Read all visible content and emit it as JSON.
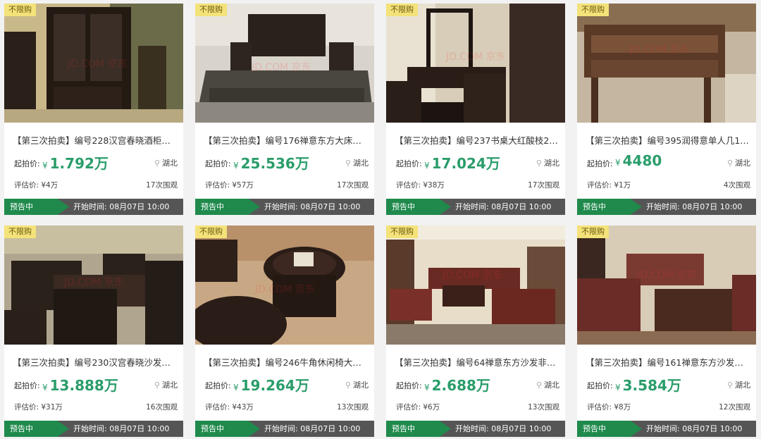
{
  "items": [
    {
      "tag": "不限购",
      "title": "【第三次拍卖】编号228汉宫春晓酒柜…",
      "price_label": "起拍价:",
      "yen": "¥",
      "price": "1.792万",
      "location": "湖北",
      "eval": "评估价: ¥4万",
      "views": "17次围观",
      "status": "预告中",
      "start_time": "开始时间: 08月07日 10:00"
    },
    {
      "tag": "不限购",
      "title": "【第三次拍卖】编号176禅意东方大床…",
      "price_label": "起拍价:",
      "yen": "¥",
      "price": "25.536万",
      "location": "湖北",
      "eval": "评估价: ¥57万",
      "views": "17次围观",
      "status": "预告中",
      "start_time": "开始时间: 08月07日 10:00"
    },
    {
      "tag": "不限购",
      "title": "【第三次拍卖】编号237书桌大红酸枝2…",
      "price_label": "起拍价:",
      "yen": "¥",
      "price": "17.024万",
      "location": "湖北",
      "eval": "评估价: ¥38万",
      "views": "17次围观",
      "status": "预告中",
      "start_time": "开始时间: 08月07日 10:00"
    },
    {
      "tag": "不限购",
      "title": "【第三次拍卖】编号395润得意单人几1…",
      "price_label": "起拍价:",
      "yen": "¥",
      "price": "4480",
      "location": "湖北",
      "eval": "评估价: ¥1万",
      "views": "4次围观",
      "status": "预告中",
      "start_time": "开始时间: 08月07日 10:00"
    },
    {
      "tag": "不限购",
      "title": "【第三次拍卖】编号230汉宫春晓沙发…",
      "price_label": "起拍价:",
      "yen": "¥",
      "price": "13.888万",
      "location": "湖北",
      "eval": "评估价: ¥31万",
      "views": "16次围观",
      "status": "预告中",
      "start_time": "开始时间: 08月07日 10:00"
    },
    {
      "tag": "不限购",
      "title": "【第三次拍卖】编号246牛角休闲椅大…",
      "price_label": "起拍价:",
      "yen": "¥",
      "price": "19.264万",
      "location": "湖北",
      "eval": "评估价: ¥43万",
      "views": "13次围观",
      "status": "预告中",
      "start_time": "开始时间: 08月07日 10:00"
    },
    {
      "tag": "不限购",
      "title": "【第三次拍卖】编号64禅意东方沙发非…",
      "price_label": "起拍价:",
      "yen": "¥",
      "price": "2.688万",
      "location": "湖北",
      "eval": "评估价: ¥6万",
      "views": "13次围观",
      "status": "预告中",
      "start_time": "开始时间: 08月07日 10:00"
    },
    {
      "tag": "不限购",
      "title": "【第三次拍卖】编号161禅意东方沙发…",
      "price_label": "起拍价:",
      "yen": "¥",
      "price": "3.584万",
      "location": "湖北",
      "eval": "评估价: ¥8万",
      "views": "12次围观",
      "status": "预告中",
      "start_time": "开始时间: 08月07日 10:00"
    }
  ],
  "watermark": "JD.COM 京东",
  "colors": {
    "price": "#2a9d6a",
    "status_bg": "#1f8a4c",
    "bar_bg": "#555555",
    "tag_bg": "#f4e27a"
  }
}
